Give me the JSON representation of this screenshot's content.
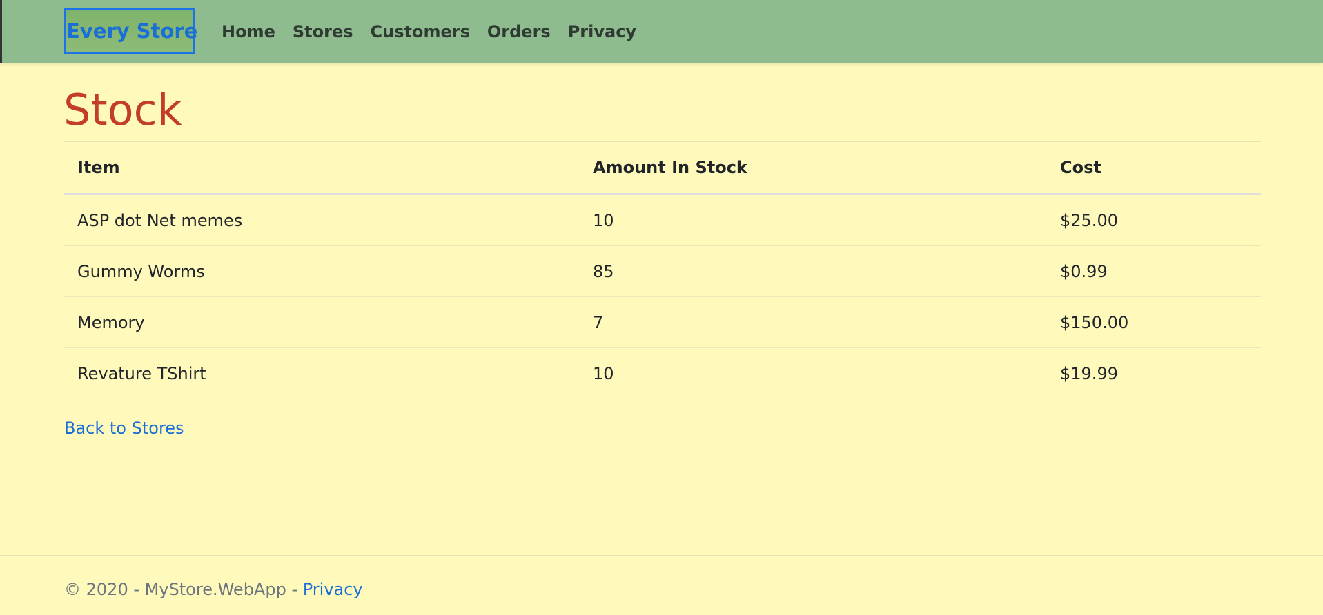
{
  "nav": {
    "brand": "Every Store",
    "links": [
      "Home",
      "Stores",
      "Customers",
      "Orders",
      "Privacy"
    ]
  },
  "page": {
    "title": "Stock"
  },
  "table": {
    "headers": [
      "Item",
      "Amount In Stock",
      "Cost"
    ],
    "rows": [
      [
        "ASP dot Net memes",
        "10",
        "$25.00"
      ],
      [
        "Gummy Worms",
        "85",
        "$0.99"
      ],
      [
        "Memory",
        "7",
        "$150.00"
      ],
      [
        "Revature TShirt",
        "10",
        "$19.99"
      ]
    ]
  },
  "back_link": "Back to Stores",
  "footer": {
    "text": "© 2020 - MyStore.WebApp - ",
    "link": "Privacy"
  },
  "colors": {
    "navbar": "#8fbc8f",
    "background": "#fffabb",
    "title": "#c33e27",
    "link": "#1a6fd6"
  }
}
